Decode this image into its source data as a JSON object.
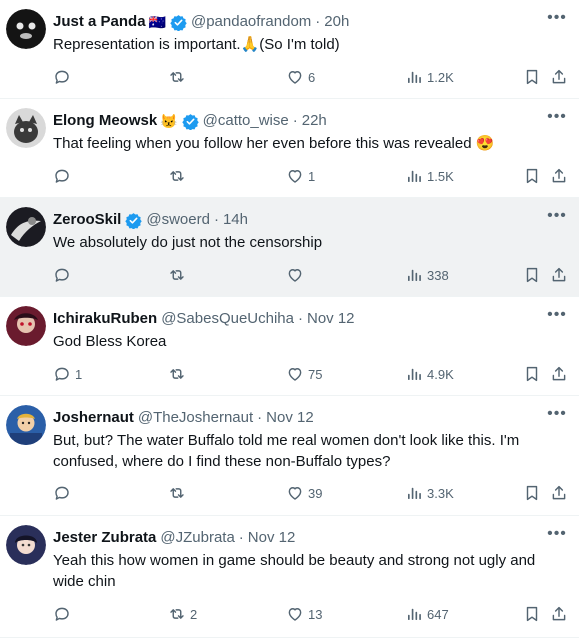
{
  "tweets": [
    {
      "name": "Just a Panda",
      "name_emoji": "🇦🇺",
      "verified": true,
      "handle": "@pandaofrandom",
      "sep": "·",
      "time": "20h",
      "text": "Representation is important.🙏(So I'm told)",
      "replies": "",
      "retweets": "",
      "likes": "6",
      "views": "1.2K",
      "avatar_color": "#141414"
    },
    {
      "name": "Elong Meowsk",
      "name_emoji": "😾",
      "verified": true,
      "handle": "@catto_wise",
      "sep": "·",
      "time": "22h",
      "text": "That  feeling when you follow her even before this was revealed 😍",
      "replies": "",
      "retweets": "",
      "likes": "1",
      "views": "1.5K",
      "avatar_color": "#3a3a3a"
    },
    {
      "name": "ZerooSkil",
      "name_emoji": "",
      "verified": true,
      "handle": "@swoerd",
      "sep": "·",
      "time": "14h",
      "text": "We absolutely do just not the censorship",
      "replies": "",
      "retweets": "",
      "likes": "",
      "views": "338",
      "avatar_color": "#1b1b22"
    },
    {
      "name": "IchirakuRuben",
      "name_emoji": "",
      "verified": false,
      "handle": "@SabesQueUchiha",
      "sep": "·",
      "time": "Nov 12",
      "text": "God Bless Korea",
      "replies": "1",
      "retweets": "",
      "likes": "75",
      "views": "4.9K",
      "avatar_color": "#6a1b2e"
    },
    {
      "name": "Joshernaut",
      "name_emoji": "",
      "verified": false,
      "handle": "@TheJoshernaut",
      "sep": "·",
      "time": "Nov 12",
      "text": "But, but? The water Buffalo told me real women don't look like this. I'm confused, where do I find these non-Buffalo types?",
      "replies": "",
      "retweets": "",
      "likes": "39",
      "views": "3.3K",
      "avatar_color": "#2b5fa8"
    },
    {
      "name": "Jester Zubrata",
      "name_emoji": "",
      "verified": false,
      "handle": "@JZubrata",
      "sep": "·",
      "time": "Nov 12",
      "text": "Yeah this how women in game  should be beauty and strong not ugly and wide chin",
      "replies": "",
      "retweets": "2",
      "likes": "13",
      "views": "647",
      "avatar_color": "#2a2f5a"
    }
  ],
  "icons": {
    "more": "more-dots-icon",
    "reply": "reply-icon",
    "retweet": "retweet-icon",
    "like": "heart-icon",
    "views": "views-icon",
    "bookmark": "bookmark-icon",
    "share": "share-icon",
    "verified": "verified-badge-icon"
  },
  "colors": {
    "text": "#0f1419",
    "muted": "#536471",
    "verified": "#1d9bf0",
    "highlight_bg": "#f0f2f3",
    "divider": "#eff3f4"
  }
}
